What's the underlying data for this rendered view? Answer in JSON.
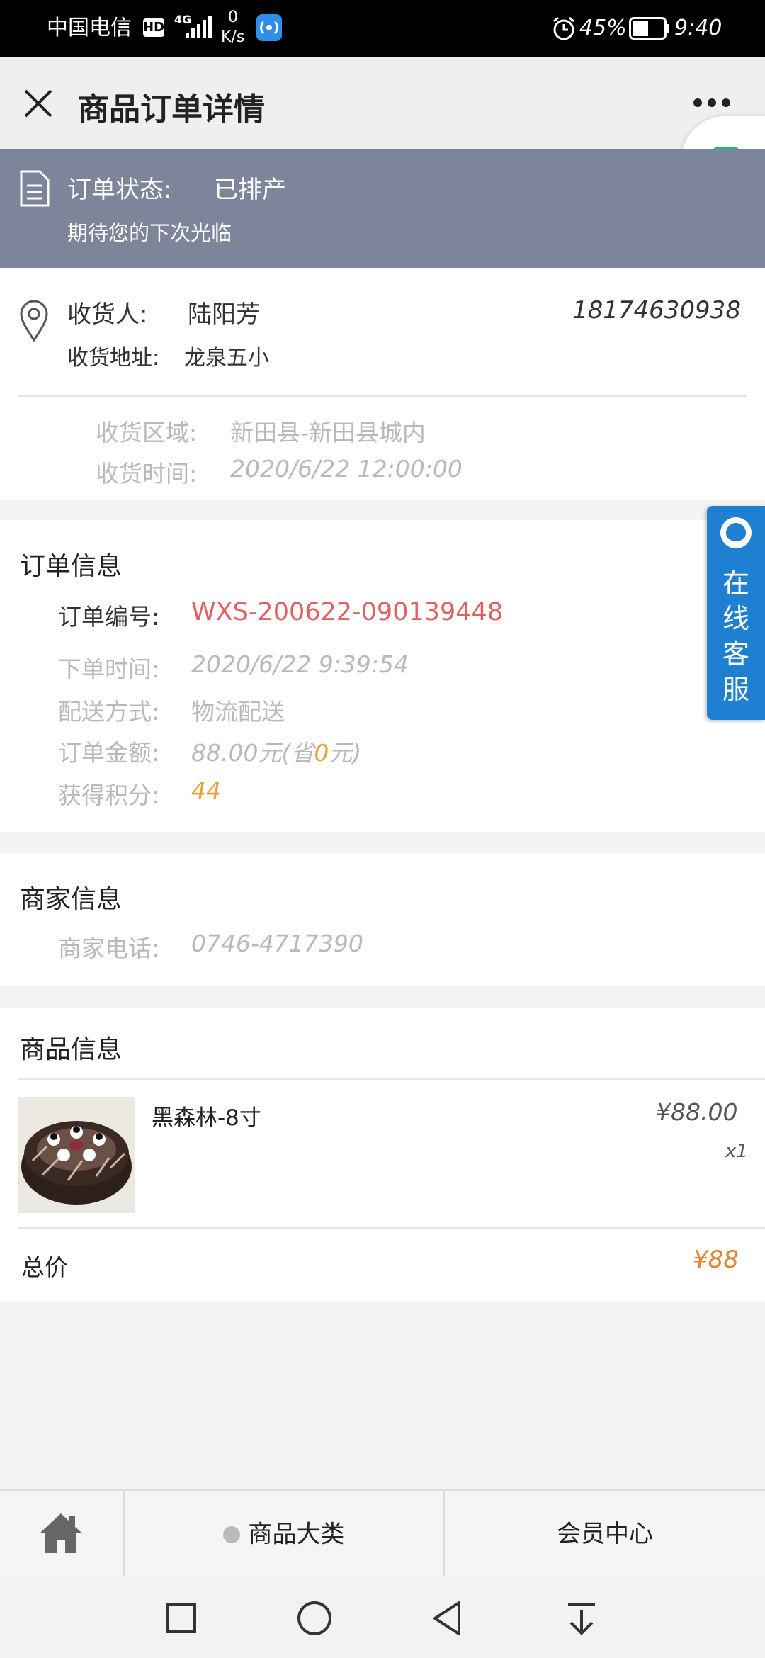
{
  "status_bar": {
    "carrier": "中国电信",
    "hd": "HD",
    "network": "4G",
    "speed_value": "0",
    "speed_unit": "K/s",
    "battery": "45%",
    "time": "9:40"
  },
  "header": {
    "title": "商品订单详情"
  },
  "order_status": {
    "label": "订单状态:",
    "value": "已排产",
    "message": "期待您的下次光临"
  },
  "address": {
    "receiver_label": "收货人:",
    "receiver_name": "陆阳芳",
    "phone": "18174630938",
    "address_label": "收货地址:",
    "address_value": "龙泉五小",
    "region_label": "收货区域:",
    "region_value": "新田县-新田县城内",
    "time_label": "收货时间:",
    "time_value": "2020/6/22 12:00:00"
  },
  "order_info": {
    "title": "订单信息",
    "number_label": "订单编号:",
    "number_value": "WXS-200622-090139448",
    "time_label": "下单时间:",
    "time_value": "2020/6/22 9:39:54",
    "delivery_label": "配送方式:",
    "delivery_value": "物流配送",
    "amount_label": "订单金额:",
    "amount_value": "88.00元(省",
    "amount_saved": "0",
    "amount_suffix": "元)",
    "points_label": "获得积分:",
    "points_value": "44"
  },
  "merchant": {
    "title": "商家信息",
    "phone_label": "商家电话:",
    "phone_value": "0746-4717390"
  },
  "products": {
    "title": "商品信息",
    "items": [
      {
        "name": "黑森林-8寸",
        "price": "¥88.00",
        "qty": "x1"
      }
    ],
    "total_label": "总价",
    "total_value": "¥88"
  },
  "service": {
    "label_chars": [
      "在",
      "线",
      "客",
      "服"
    ]
  },
  "bottom_nav": {
    "categories": "商品大类",
    "member": "会员中心"
  },
  "colors": {
    "banner": "#7c8599",
    "order_number": "#e06161",
    "accent_orange": "#e9a23b",
    "service_blue": "#1f7fd1"
  }
}
